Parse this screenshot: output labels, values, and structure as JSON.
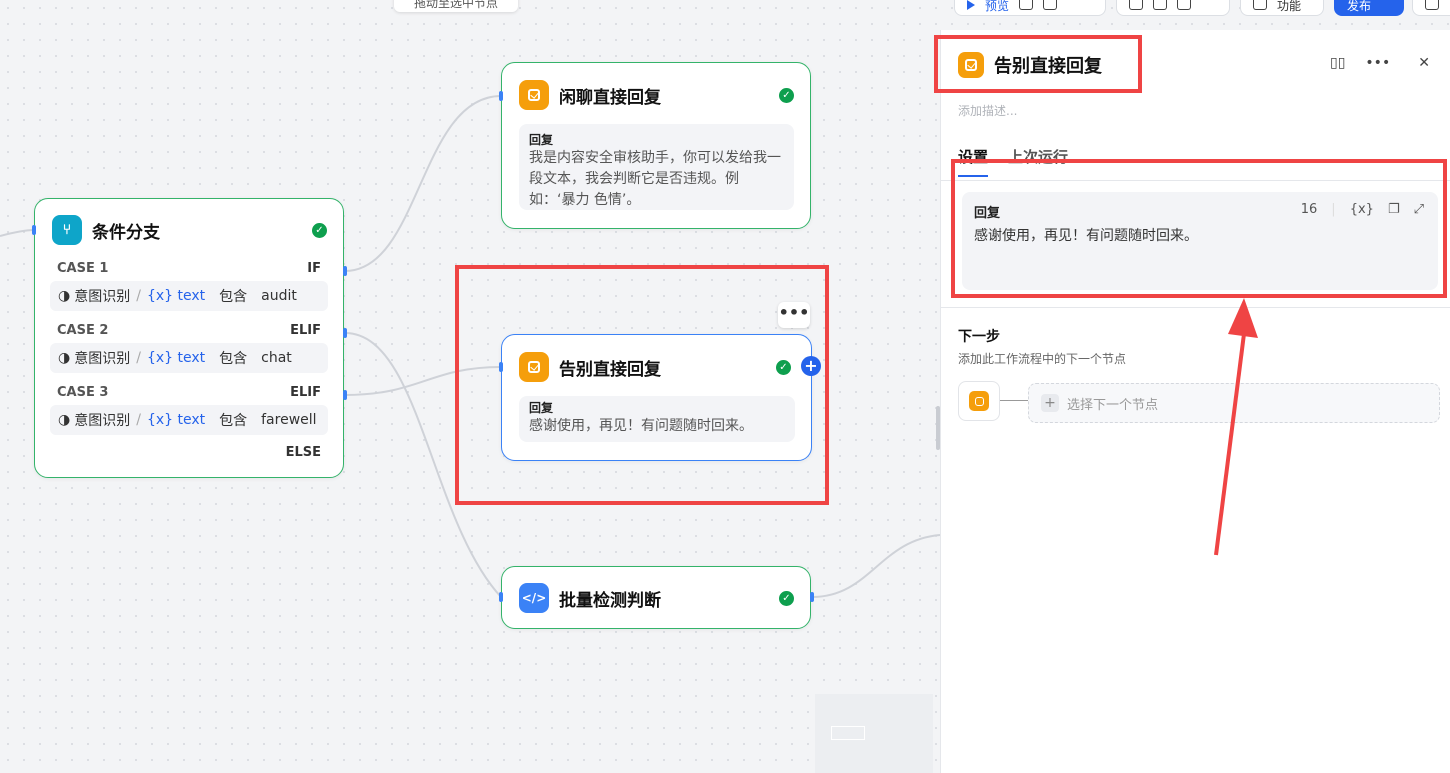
{
  "top_hint": "拖动至选中节点",
  "toolbar": {
    "run_label": "预览",
    "feature_label": "功能",
    "publish_label": "发布"
  },
  "nodes": {
    "chitchat": {
      "title": "闲聊直接回复",
      "reply_label": "回复",
      "reply_text": "我是内容安全审核助手，你可以发给我一段文本，我会判断它是否违规。例如：‘暴力 色情’。"
    },
    "farewell": {
      "title": "告别直接回复",
      "reply_label": "回复",
      "reply_text": "感谢使用，再见！有问题随时回来。",
      "more_label": "•••"
    },
    "batch": {
      "title": "批量检测判断"
    },
    "condition": {
      "title": "条件分支",
      "cases": [
        {
          "name": "CASE 1",
          "keyword": "IF",
          "source": "意图识别",
          "var": "{x} text",
          "op": "包含",
          "value": "audit"
        },
        {
          "name": "CASE 2",
          "keyword": "ELIF",
          "source": "意图识别",
          "var": "{x} text",
          "op": "包含",
          "value": "chat"
        },
        {
          "name": "CASE 3",
          "keyword": "ELIF",
          "source": "意图识别",
          "var": "{x} text",
          "op": "包含",
          "value": "farewell"
        }
      ],
      "else_label": "ELSE"
    }
  },
  "panel": {
    "title": "告别直接回复",
    "description_placeholder": "添加描述...",
    "tabs": [
      "设置",
      "上次运行"
    ],
    "reply": {
      "label": "回复",
      "char_count": "16",
      "var_label": "{x}",
      "text": "感谢使用，再见！有问题随时回来。"
    },
    "next": {
      "title": "下一步",
      "subtitle": "添加此工作流程中的下一个节点",
      "select_placeholder": "选择下一个节点"
    }
  },
  "colors": {
    "node_border_ok": "#34b36a",
    "selected_border": "#3b82f6",
    "accent": "#2563eb",
    "annotation": "#ef4444"
  }
}
